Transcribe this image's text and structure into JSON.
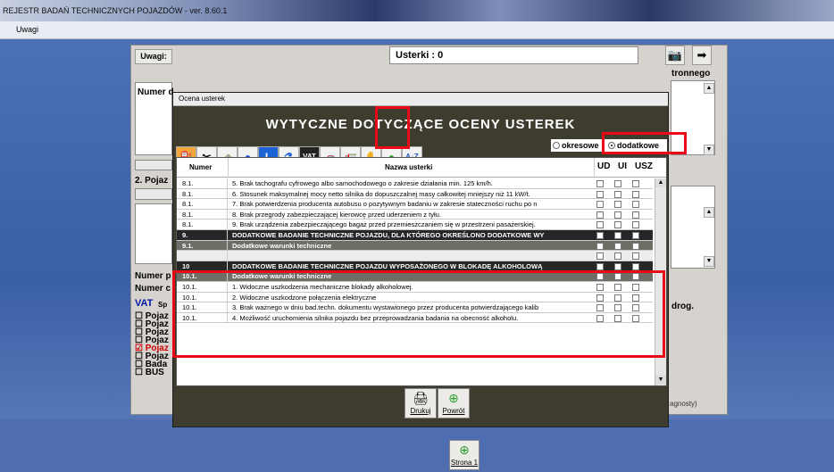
{
  "window": {
    "title": "REJESTR BADAŃ TECHNICZNYCH POJAZDÓW  -  ver. 8.60.1"
  },
  "menu": {
    "item": "Uwagi"
  },
  "background_form": {
    "uwagi_label": "Uwagi:",
    "usterki_label": "Usterki :  0",
    "right_label": "tronnego",
    "numer_label": "Numer d",
    "pojazd_label": "2. Pojaz",
    "numer_p": "Numer p",
    "numer_c": "Numer c",
    "vat_label": "VAT",
    "vat_sub": "Sp",
    "drog_label": "drog.",
    "agnosty_label": "agnosty)",
    "checklist": [
      "☐ Pojaz",
      "☐ Pojaz",
      "☐ Pojaz",
      "☐ Pojaz",
      "☑ Pojaz",
      "☐ Pojaz",
      "☐ Bada",
      "☐ BUS"
    ]
  },
  "dialog": {
    "caption": "Ocena usterek",
    "heading": "WYTYCZNE DOTYCZĄCE OCENY USTEREK",
    "toolbar_icons": [
      "fuel-icon",
      "tools-icon",
      "car-icon",
      "beacon-icon",
      "l-letter-icon",
      "flask-icon",
      "vat-icon",
      "blue-car-icon",
      "trailer-icon",
      "red-lock-icon",
      "green-ball-icon",
      "sort-az-icon"
    ],
    "toolbar_glyphs": [
      "⛽",
      "✂",
      "🚕",
      "●",
      "L",
      "⚗",
      "VAT",
      "🚗",
      "🚛",
      "✋",
      "●",
      "A↓Z"
    ],
    "counters": [
      "0",
      "0",
      "0",
      "0",
      "0",
      "0",
      "0",
      "0",
      "0",
      "0"
    ],
    "radio_okresowe": "okresowe",
    "radio_dodatkowe": "dodatkowe",
    "columns": {
      "numer": "Numer",
      "nazwa": "Nazwa usterki",
      "ud": "UD",
      "ui": "UI",
      "usz": "USZ"
    },
    "rows": [
      {
        "num": "8.1.",
        "name": "5. Brak tachografu cyfrowego albo samochodowego o zakresie działania min. 125 km/h.",
        "style": "normal"
      },
      {
        "num": "8.1.",
        "name": "6. Stosunek maksymalnej mocy netto silnika do dopuszczalnej masy całkowitej mniejszy niż 11 kW/t.",
        "style": "normal"
      },
      {
        "num": "8.1.",
        "name": "7. Brak potwierdzenia producenta autobusu o pozytywnym badaniu w zakresie stateczności ruchu po n",
        "style": "normal"
      },
      {
        "num": "8.1.",
        "name": "8. Brak przegrody zabezpieczającej kierowcę przed uderzeniem z tyłu.",
        "style": "normal"
      },
      {
        "num": "8.1.",
        "name": "9. Brak urządzenia zabezpieczającego bagaż przed przemieszczaniem się w przestrzeni pasażerskiej.",
        "style": "normal"
      },
      {
        "num": "9.",
        "name": "DODATKOWE BADANIE TECHNICZNE POJAZDU, DLA KTÓREGO OKREŚLONO DODATKOWE WY",
        "style": "dark"
      },
      {
        "num": "9.1.",
        "name": "Dodatkowe warunki techniczne",
        "style": "mid"
      },
      {
        "num": "",
        "name": "",
        "style": "grey"
      },
      {
        "num": "10",
        "name": "DODATKOWE BADANIE TECHNICZNE POJAZDU WYPOSAŻONEGO W BLOKADĘ ALKOHOLOWĄ",
        "style": "dark"
      },
      {
        "num": "10.1.",
        "name": "Dodatkowe warunki techniczne",
        "style": "mid"
      },
      {
        "num": "10.1.",
        "name": "1. Widoczne uszkodzenia mechaniczne blokady alkoholowej.",
        "style": "normal"
      },
      {
        "num": "10.1.",
        "name": "2. Widoczne uszkodzone połączenia elektryczne",
        "style": "normal"
      },
      {
        "num": "10.1.",
        "name": "3. Brak ważnego w dniu bad.techn. dokumentu wystawionego przez producenta potwierdzającego kalib",
        "style": "normal"
      },
      {
        "num": "10.1.",
        "name": "4. Możliwość uruchomienia silnika pojazdu bez przeprowadzania badania na obecność alkoholu.",
        "style": "normal"
      }
    ],
    "print_button": "Drukuj",
    "back_button": "Powrót"
  },
  "footer": {
    "page_button": "Strona 1"
  },
  "colors": {
    "highlight": "#ea0a17",
    "dialog_bg": "#3d3c2f",
    "desktop_bg": "#3d62a6"
  }
}
